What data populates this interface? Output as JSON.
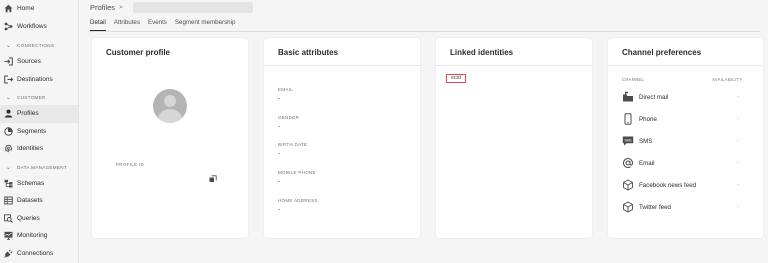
{
  "sidebar": {
    "items": [
      {
        "label": "Home"
      },
      {
        "label": "Workflows"
      }
    ],
    "sections": [
      {
        "title": "CONNECTIONS",
        "items": [
          {
            "label": "Sources"
          },
          {
            "label": "Destinations"
          }
        ]
      },
      {
        "title": "CUSTOMER",
        "items": [
          {
            "label": "Profiles",
            "active": true
          },
          {
            "label": "Segments"
          },
          {
            "label": "Identities"
          }
        ]
      },
      {
        "title": "DATA MANAGEMENT",
        "items": [
          {
            "label": "Schemas"
          },
          {
            "label": "Datasets"
          },
          {
            "label": "Queries"
          },
          {
            "label": "Monitoring"
          },
          {
            "label": "Connections"
          }
        ]
      }
    ]
  },
  "header": {
    "breadcrumb": "Profiles",
    "tabs": [
      {
        "label": "Detail",
        "active": true
      },
      {
        "label": "Attributes"
      },
      {
        "label": "Events"
      },
      {
        "label": "Segment membership"
      }
    ]
  },
  "customer_profile": {
    "title": "Customer profile",
    "profile_id_label": "PROFILE ID"
  },
  "basic_attributes": {
    "title": "Basic attributes",
    "items": [
      {
        "label": "EMAIL",
        "value": "-"
      },
      {
        "label": "GENDER",
        "value": "-"
      },
      {
        "label": "BIRTH DATE",
        "value": "-"
      },
      {
        "label": "MOBILE PHONE",
        "value": "-"
      },
      {
        "label": "HOME ADDRESS",
        "value": "-"
      }
    ]
  },
  "linked_identities": {
    "title": "Linked identities",
    "tag": "ecid"
  },
  "channel_preferences": {
    "title": "Channel preferences",
    "col_channel": "CHANNEL",
    "col_availability": "AVAILABILITY",
    "channels": [
      {
        "label": "Direct mail",
        "availability": "-",
        "icon": "mailbox-icon"
      },
      {
        "label": "Phone",
        "availability": "-",
        "icon": "phone-icon"
      },
      {
        "label": "SMS",
        "availability": "-",
        "icon": "sms-icon"
      },
      {
        "label": "Email",
        "availability": "-",
        "icon": "at-sign-icon"
      },
      {
        "label": "Facebook news feed",
        "availability": "-",
        "icon": "cube-icon"
      },
      {
        "label": "Twitter feed",
        "availability": "-",
        "icon": "cube-icon"
      }
    ]
  },
  "colors": {
    "accent_red": "#e34850",
    "text": "#2c2c2c",
    "muted": "#707070"
  }
}
